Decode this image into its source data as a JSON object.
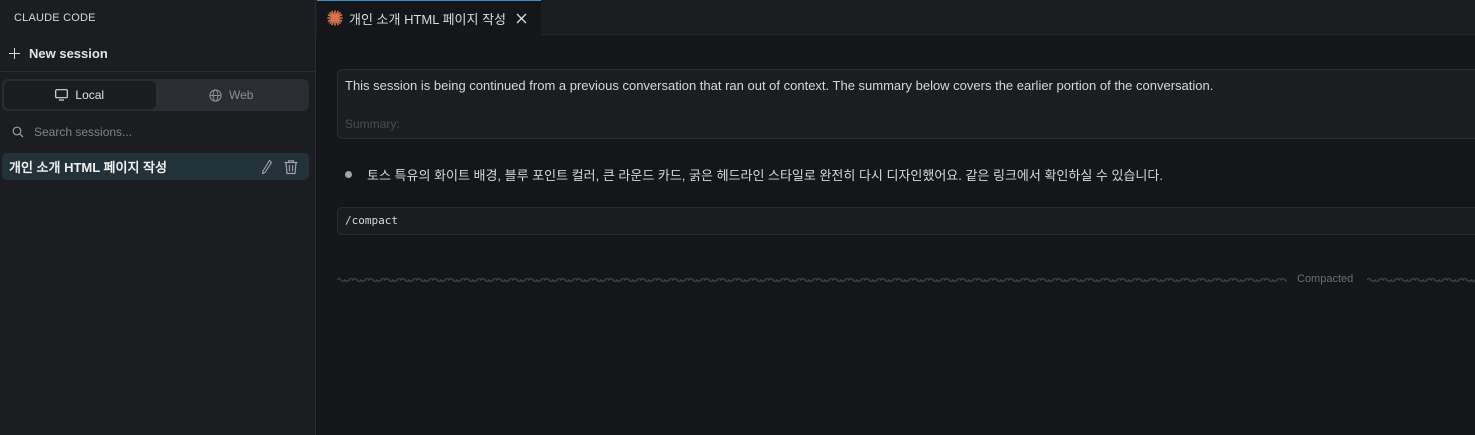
{
  "sidebar": {
    "header": "CLAUDE CODE",
    "new_session_label": "New session",
    "toggle": {
      "local_label": "Local",
      "web_label": "Web",
      "active": "Local"
    },
    "search_placeholder": "Search sessions...",
    "sessions": [
      {
        "title": "개인 소개 HTML 페이지 작성"
      }
    ]
  },
  "tab": {
    "title": "개인 소개 HTML 페이지 작성",
    "icon": "claude-asterisk-icon",
    "accent": "#d9734a"
  },
  "conversation": {
    "summary_text": "This session is being continued from a previous conversation that ran out of context. The summary below covers the earlier portion of the conversation.",
    "summary_faded": "Summary:",
    "assistant_message": "토스 특유의 화이트 배경, 블루 포인트 컬러, 큰 라운드 카드, 굵은 헤드라인 스타일로 완전히 다시 디자인했어요. 같은 링크에서 확인하실 수 있습니다.",
    "command_text": "/compact",
    "divider_label": "Compacted"
  },
  "colors": {
    "tab_accent": "#3b8ed0",
    "selected_session_bg": "#23313a"
  }
}
